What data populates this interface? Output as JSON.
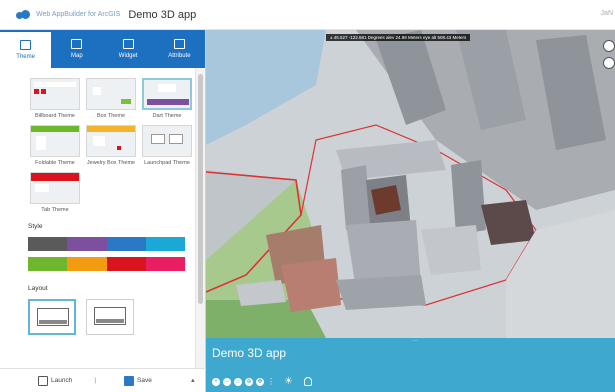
{
  "header": {
    "brand": "Web AppBuilder for ArcGIS",
    "app_title": "Demo 3D app",
    "user": "JaN"
  },
  "tabs": [
    {
      "label": "Theme",
      "active": true,
      "icon": "theme-icon"
    },
    {
      "label": "Map",
      "active": false,
      "icon": "map-icon"
    },
    {
      "label": "Widget",
      "active": false,
      "icon": "widget-icon"
    },
    {
      "label": "Attribute",
      "active": false,
      "icon": "attribute-icon"
    }
  ],
  "themes": [
    {
      "name": "Billboard Theme",
      "selected": false
    },
    {
      "name": "Box Theme",
      "selected": false
    },
    {
      "name": "Dart Theme",
      "selected": true
    },
    {
      "name": "Foldable Theme",
      "selected": false
    },
    {
      "name": "Jewelry Box Theme",
      "selected": false
    },
    {
      "name": "Launchpad Theme",
      "selected": false
    },
    {
      "name": "Tab Theme",
      "selected": false
    }
  ],
  "style": {
    "title": "Style",
    "rows": [
      [
        "#5a5a5a",
        "#7c4f9f",
        "#2b78c4",
        "#1aa9d6"
      ],
      [
        "#6eb62b",
        "#f39c12",
        "#d9141e",
        "#e91e63"
      ]
    ]
  },
  "layout": {
    "title": "Layout",
    "options": [
      {
        "selected": true
      },
      {
        "selected": false
      }
    ]
  },
  "footer": {
    "launch_label": "Launch",
    "save_label": "Save"
  },
  "map": {
    "coords": "± 45.527 -122.681 Degrees   alev 24.98 Meters   eye alt 508.43 Meters",
    "title": "Demo 3D app",
    "accent": "#3fa8cf"
  }
}
